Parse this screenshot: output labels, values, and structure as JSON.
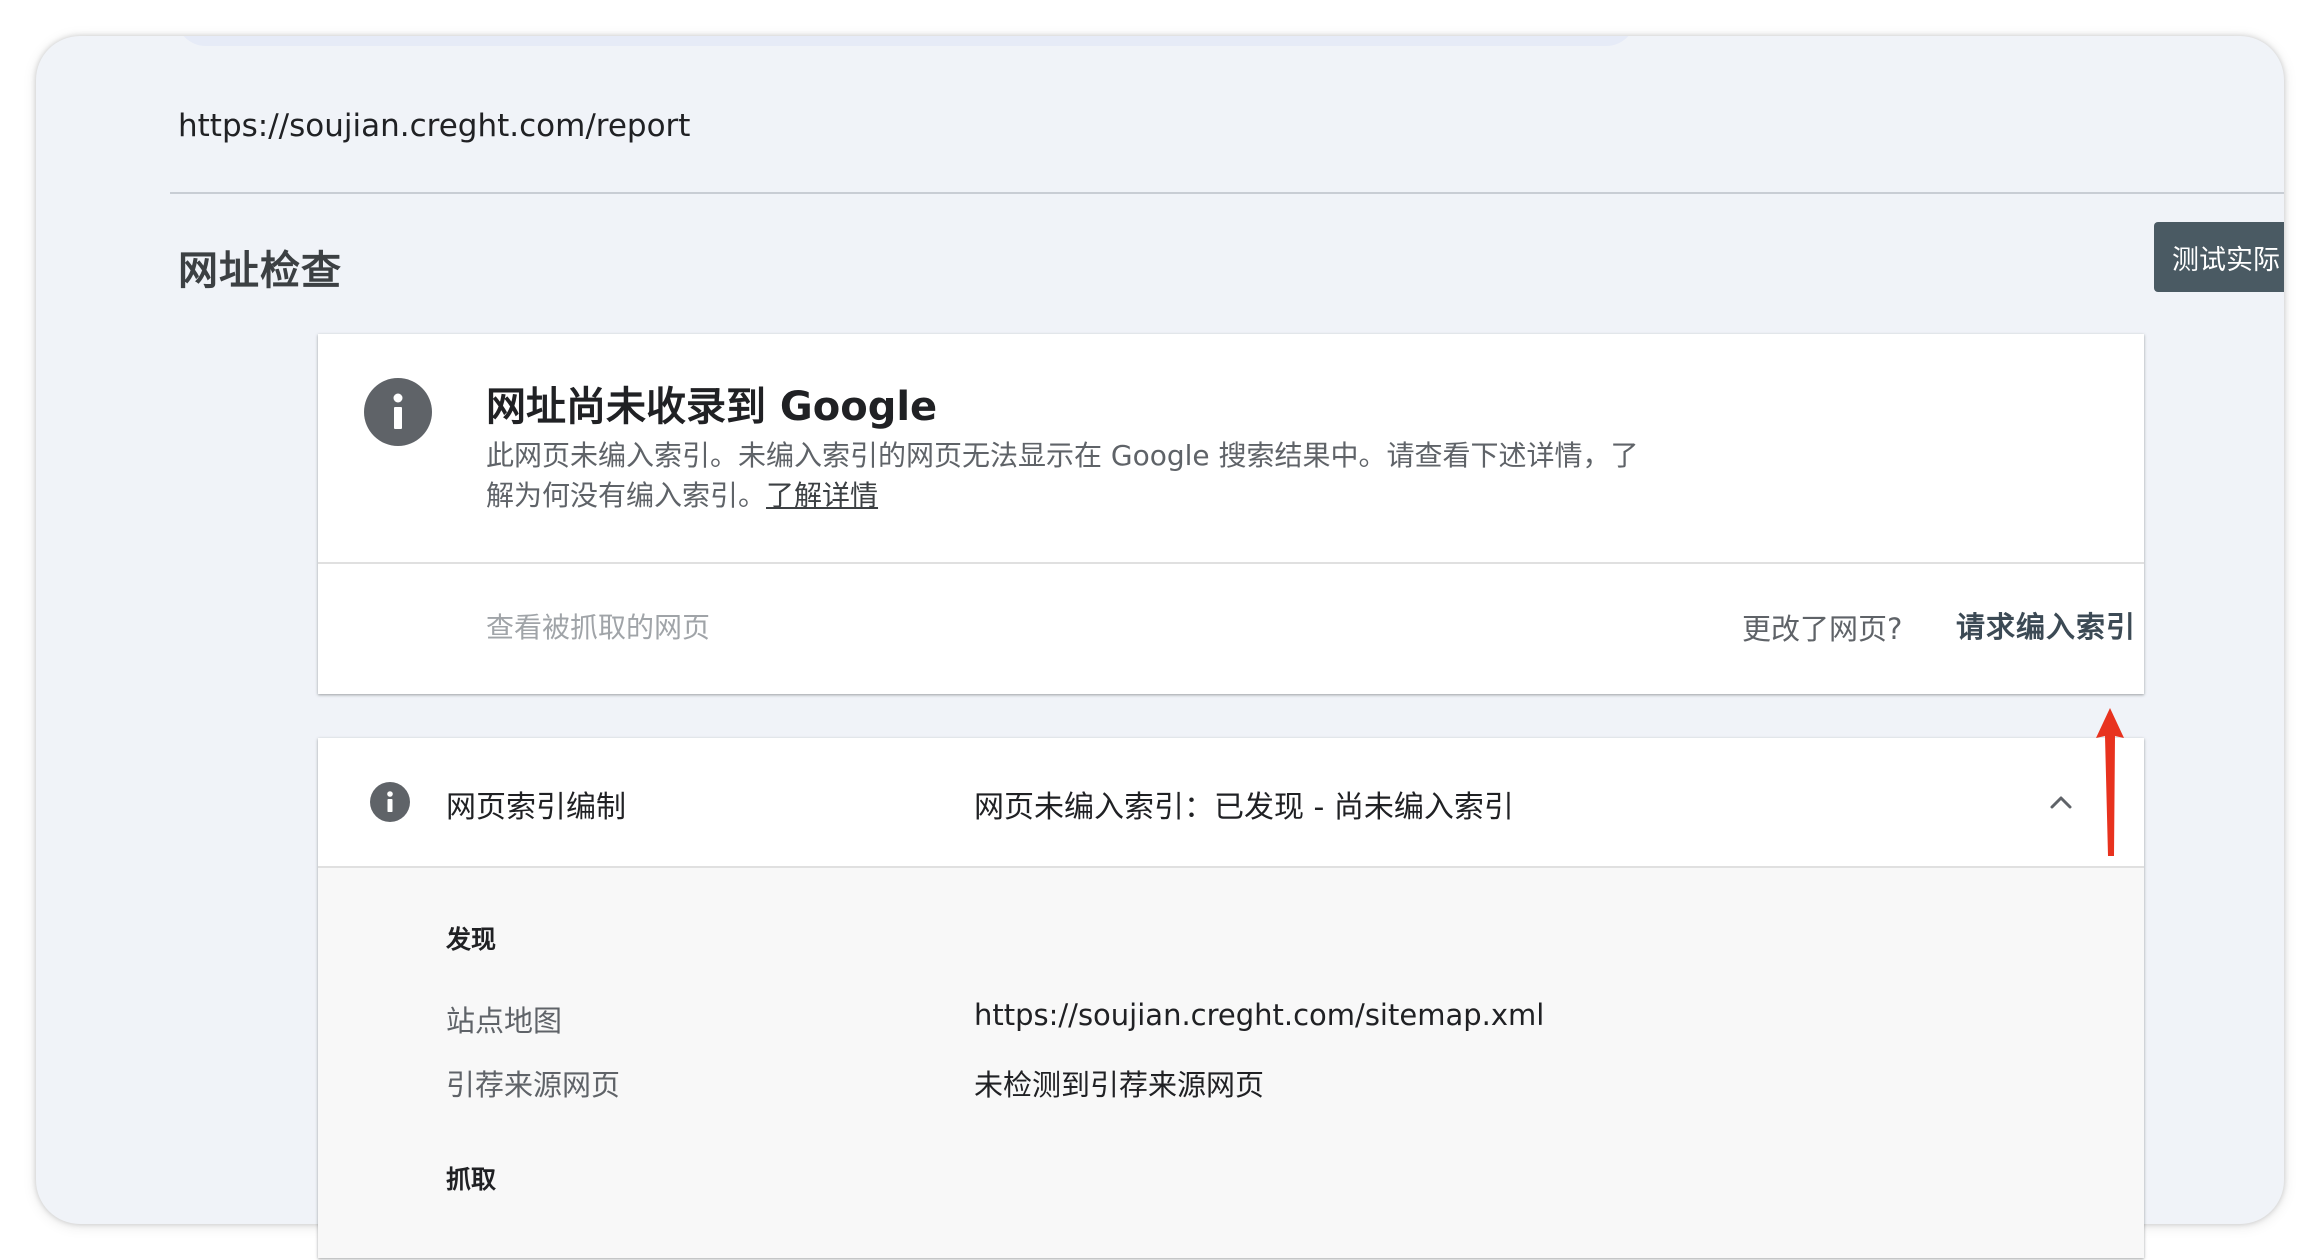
{
  "inspected_url": "https://soujian.creght.com/report",
  "page_title": "网址检查",
  "test_live_label": "测试实际",
  "status_card": {
    "icon": "info-icon",
    "title": "网址尚未收录到 Google",
    "description": "此网页未编入索引。未编入索引的网页无法显示在 Google 搜索结果中。请查看下述详情，了解为何没有编入索引。",
    "learn_more": "了解详情",
    "view_crawled_page": "查看被抓取的网页",
    "page_changed": "更改了网页?",
    "request_indexing": "请求编入索引"
  },
  "indexing_card": {
    "icon": "info-icon",
    "label": "网页索引编制",
    "status": "网页未编入索引：已发现 - 尚未编入索引",
    "discovery": {
      "heading": "发现",
      "sitemap_label": "站点地图",
      "sitemap_value": "https://soujian.creght.com/sitemap.xml",
      "referring_label": "引荐来源网页",
      "referring_value": "未检测到引荐来源网页"
    },
    "crawl": {
      "heading": "抓取"
    }
  },
  "colors": {
    "background": "#f0f3f8",
    "card": "#ffffff",
    "button_dark": "#4a5a63",
    "arrow": "#e8321e"
  }
}
